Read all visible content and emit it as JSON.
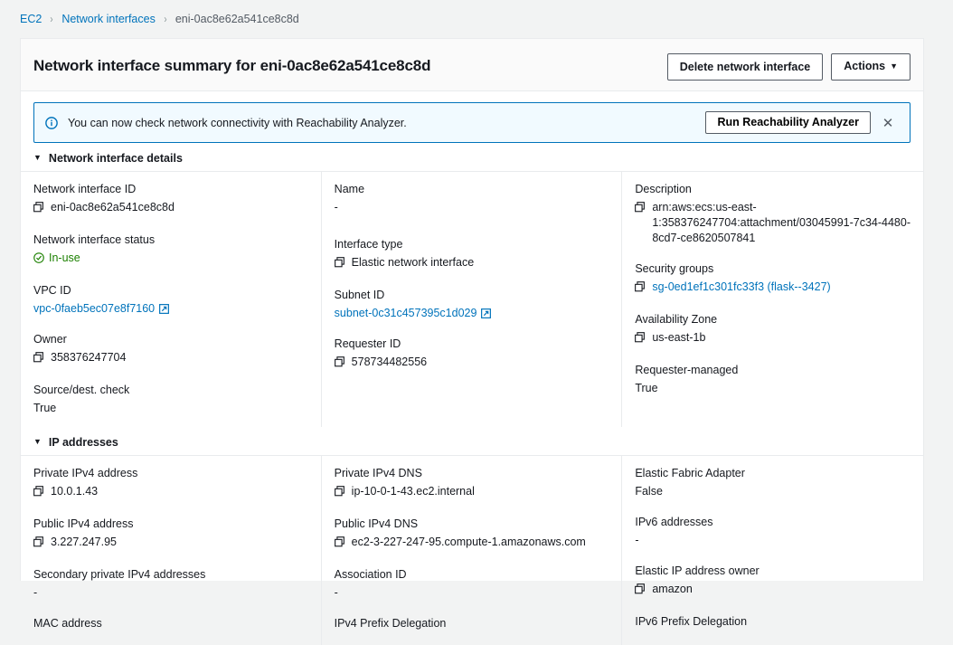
{
  "breadcrumb": {
    "items": [
      {
        "label": "EC2",
        "type": "link"
      },
      {
        "label": "Network interfaces",
        "type": "link"
      },
      {
        "label": "eni-0ac8e62a541ce8c8d",
        "type": "current"
      }
    ],
    "separator": "›"
  },
  "header": {
    "title": "Network interface summary for eni-0ac8e62a541ce8c8d",
    "delete_button": "Delete network interface",
    "actions_button": "Actions",
    "actions_caret": "▼"
  },
  "banner": {
    "icon": "info-icon",
    "message": "You can now check network connectivity with Reachability Analyzer.",
    "action_button": "Run Reachability Analyzer",
    "close_label": "✕"
  },
  "sections": [
    {
      "id": "network-interface-details",
      "title": "Network interface details",
      "triangle": "▼",
      "columns": [
        {
          "fields": [
            {
              "label": "Network interface ID",
              "value": "eni-0ac8e62a541ce8c8d",
              "copy": true
            },
            {
              "label": "Network interface status",
              "value": "In-use",
              "status": true
            },
            {
              "label": "VPC ID",
              "value": "vpc-0faeb5ec07e8f7160",
              "link": true,
              "external": true
            },
            {
              "label": "Owner",
              "value": "358376247704",
              "copy": true
            },
            {
              "label": "Source/dest. check",
              "value": "True"
            }
          ]
        },
        {
          "fields": [
            {
              "label": "Name",
              "value": "-"
            },
            {
              "label": "Interface type",
              "value": "Elastic network interface",
              "copy": true
            },
            {
              "label": "Subnet ID",
              "value": "subnet-0c31c457395c1d029",
              "link": true,
              "external": true
            },
            {
              "label": "Requester ID",
              "value": "578734482556",
              "copy": true
            }
          ]
        },
        {
          "fields": [
            {
              "label": "Description",
              "value": "arn:aws:ecs:us-east-1:358376247704:attachment/03045991-7c34-4480-8cd7-ce8620507841",
              "copy": true
            },
            {
              "label": "Security groups",
              "value": "sg-0ed1ef1c301fc33f3 (flask--3427)",
              "copy": true,
              "link": true
            },
            {
              "label": "Availability Zone",
              "value": "us-east-1b",
              "copy": true
            },
            {
              "label": "Requester-managed",
              "value": "True"
            }
          ]
        }
      ]
    },
    {
      "id": "ip-addresses",
      "title": "IP addresses",
      "triangle": "▼",
      "columns": [
        {
          "fields": [
            {
              "label": "Private IPv4 address",
              "value": "10.0.1.43",
              "copy": true
            },
            {
              "label": "Public IPv4 address",
              "value": "3.227.247.95",
              "copy": true
            },
            {
              "label": "Secondary private IPv4 addresses",
              "value": "-"
            },
            {
              "label": "MAC address",
              "value": "",
              "cut": true
            }
          ]
        },
        {
          "fields": [
            {
              "label": "Private IPv4 DNS",
              "value": "ip-10-0-1-43.ec2.internal",
              "copy": true
            },
            {
              "label": "Public IPv4 DNS",
              "value": "ec2-3-227-247-95.compute-1.amazonaws.com",
              "copy": true
            },
            {
              "label": "Association ID",
              "value": "-"
            },
            {
              "label": "IPv4 Prefix Delegation",
              "value": "",
              "cut": true
            }
          ]
        },
        {
          "fields": [
            {
              "label": "Elastic Fabric Adapter",
              "value": "False"
            },
            {
              "label": "IPv6 addresses",
              "value": "-"
            },
            {
              "label": "Elastic IP address owner",
              "value": "amazon",
              "copy": true
            },
            {
              "label": "IPv6 Prefix Delegation",
              "value": "",
              "cut": true
            }
          ]
        }
      ]
    }
  ],
  "colors": {
    "link": "#0073bb",
    "status_success": "#1d8102",
    "banner_bg": "#f1faff",
    "banner_border": "#0073bb",
    "page_bg": "#f2f3f3",
    "divider": "#e9ebed"
  }
}
